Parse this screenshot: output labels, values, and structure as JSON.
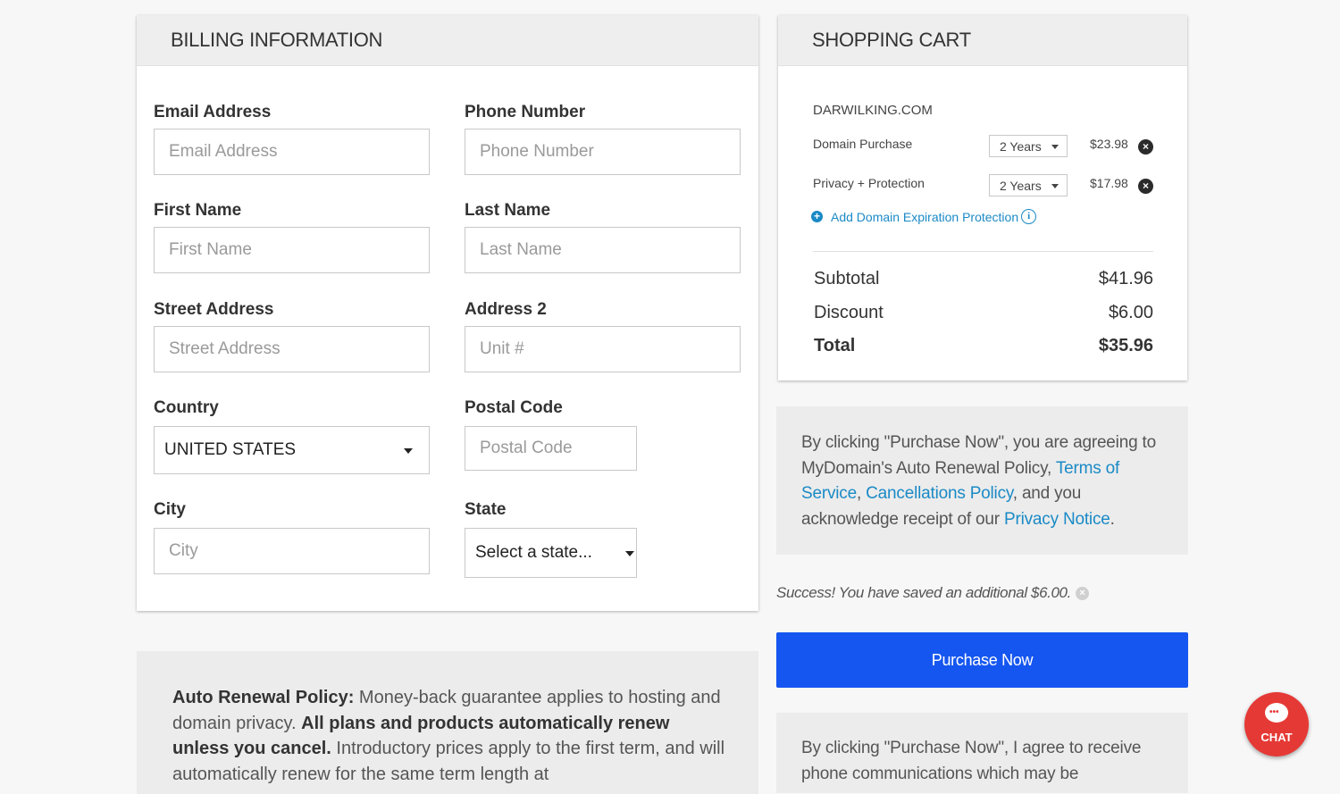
{
  "billing": {
    "title": "BILLING INFORMATION",
    "email": {
      "label": "Email Address",
      "placeholder": "Email Address"
    },
    "phone": {
      "label": "Phone Number",
      "placeholder": "Phone Number"
    },
    "first_name": {
      "label": "First Name",
      "placeholder": "First Name"
    },
    "last_name": {
      "label": "Last Name",
      "placeholder": "Last Name"
    },
    "street": {
      "label": "Street Address",
      "placeholder": "Street Address"
    },
    "address2": {
      "label": "Address 2",
      "placeholder": "Unit #"
    },
    "country": {
      "label": "Country",
      "value": "UNITED STATES"
    },
    "postal": {
      "label": "Postal Code",
      "placeholder": "Postal Code"
    },
    "city": {
      "label": "City",
      "placeholder": "City"
    },
    "state": {
      "label": "State",
      "value": "Select a state..."
    }
  },
  "cart": {
    "title": "SHOPPING CART",
    "domain": "DARWILKING.COM",
    "items": [
      {
        "name": "Domain Purchase",
        "term": "2 Years",
        "price": "$23.98"
      },
      {
        "name": "Privacy + Protection",
        "term": "2 Years",
        "price": "$17.98"
      }
    ],
    "add_link": "Add Domain Expiration Protection",
    "subtotal_label": "Subtotal",
    "subtotal_value": "$41.96",
    "discount_label": "Discount",
    "discount_value": "$6.00",
    "total_label": "Total",
    "total_value": "$35.96"
  },
  "agreement": {
    "text1": "By clicking \"Purchase Now\", you are agreeing to MyDomain's Auto Renewal Policy,",
    "terms_link": "Terms of Service",
    "comma": ",",
    "cancel_link": "Cancellations Policy",
    "text2": ", and you acknowledge receipt of our",
    "privacy_link": "Privacy Notice",
    "period": "."
  },
  "success_message": "Success! You have saved an additional $6.00.",
  "purchase_button": "Purchase Now",
  "phone_consent": "By clicking \"Purchase Now\", I agree to receive phone communications which may be",
  "auto_renewal": {
    "heading": "Auto Renewal Policy:",
    "text1": " Money-back guarantee applies to hosting and domain privacy. ",
    "bold2": "All plans and products automatically renew unless you cancel.",
    "text2": " Introductory prices apply to the first term, and will automatically renew for the same term length at"
  },
  "chat": {
    "label": "CHAT",
    "color": "#e53935"
  },
  "colors": {
    "accent": "#1556f0",
    "link": "#1a8ac6"
  }
}
